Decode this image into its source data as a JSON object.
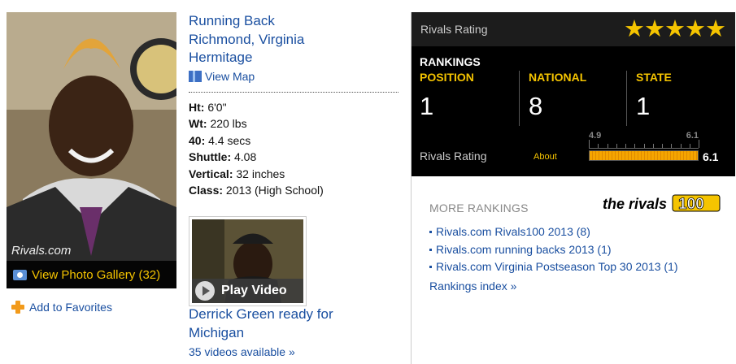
{
  "profile": {
    "position_line": "Running Back",
    "hometown": "Richmond, Virginia",
    "school": "Hermitage",
    "view_map": "View Map"
  },
  "photo": {
    "watermark": "Rivals.com",
    "gallery_label": "View Photo Gallery (32)"
  },
  "favorites_label": "Add to Favorites",
  "stats": [
    {
      "label": "Ht:",
      "value": "6'0\""
    },
    {
      "label": "Wt:",
      "value": "220 lbs"
    },
    {
      "label": "40:",
      "value": "4.4 secs"
    },
    {
      "label": "Shuttle:",
      "value": "4.08"
    },
    {
      "label": "Vertical:",
      "value": "32 inches"
    },
    {
      "label": "Class:",
      "value": "2013 (High School)"
    }
  ],
  "video": {
    "play_label": "Play Video",
    "title": "Derrick Green ready for Michigan",
    "count_link": "35 videos available »"
  },
  "rating": {
    "header_label": "Rivals Rating",
    "stars": "★★★★★",
    "star_count": 5,
    "rankings_title": "RANKINGS",
    "columns": [
      {
        "header": "POSITION",
        "value": "1"
      },
      {
        "header": "NATIONAL",
        "value": "8"
      },
      {
        "header": "STATE",
        "value": "1"
      }
    ],
    "bottom_label": "Rivals Rating",
    "about": "About",
    "scale_min": "4.9",
    "scale_max": "6.1",
    "value": "6.1",
    "fill_fraction": 1.0
  },
  "more_rankings": {
    "title": "MORE RANKINGS",
    "logo_text": "the rivals100",
    "items": [
      "Rivals.com Rivals100 2013 (8)",
      "Rivals.com running backs 2013 (1)",
      "Rivals.com Virginia Postseason Top 30 2013 (1)"
    ],
    "index_link": "Rankings index »"
  },
  "colors": {
    "link": "#1a4fa0",
    "accent": "#f5c400",
    "panel": "#000000"
  }
}
